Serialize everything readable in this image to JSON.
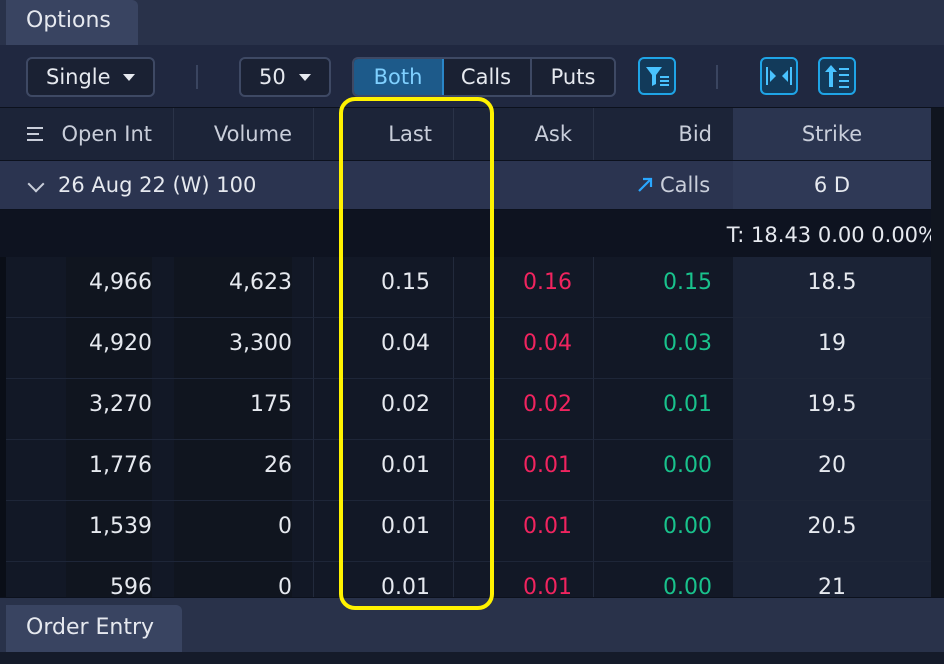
{
  "panels": {
    "options_tab": "Options",
    "order_entry_tab": "Order Entry"
  },
  "toolbar": {
    "strategy_select": "Single",
    "strikes_select": "50",
    "segments": [
      "Both",
      "Calls",
      "Puts"
    ],
    "active_segment": "Both",
    "icons": [
      "filter-icon",
      "split-columns-icon",
      "sort-icon"
    ]
  },
  "columns": {
    "menu_icon": "menu-lines-icon",
    "open_int": "Open Int",
    "volume": "Volume",
    "last": "Last",
    "ask": "Ask",
    "bid": "Bid",
    "strike": "Strike"
  },
  "group": {
    "label": "26 Aug 22 (W) 100",
    "side": "Calls",
    "days": "6 D"
  },
  "underlying": {
    "text": "T: 18.43 0.00 0.00%"
  },
  "rows": [
    {
      "open_int": "4,966",
      "volume": "4,623",
      "last": "0.15",
      "ask": "0.16",
      "bid": "0.15",
      "strike": "18.5"
    },
    {
      "open_int": "4,920",
      "volume": "3,300",
      "last": "0.04",
      "ask": "0.04",
      "bid": "0.03",
      "strike": "19"
    },
    {
      "open_int": "3,270",
      "volume": "175",
      "last": "0.02",
      "ask": "0.02",
      "bid": "0.01",
      "strike": "19.5"
    },
    {
      "open_int": "1,776",
      "volume": "26",
      "last": "0.01",
      "ask": "0.01",
      "bid": "0.00",
      "strike": "20"
    },
    {
      "open_int": "1,539",
      "volume": "0",
      "last": "0.01",
      "ask": "0.01",
      "bid": "0.00",
      "strike": "20.5"
    },
    {
      "open_int": "596",
      "volume": "0",
      "last": "0.01",
      "ask": "0.01",
      "bid": "0.00",
      "strike": "21"
    }
  ],
  "colors": {
    "ask": "#f0245f",
    "bid": "#19c28c",
    "accent": "#1fa4e6",
    "highlight": "#fff200"
  }
}
